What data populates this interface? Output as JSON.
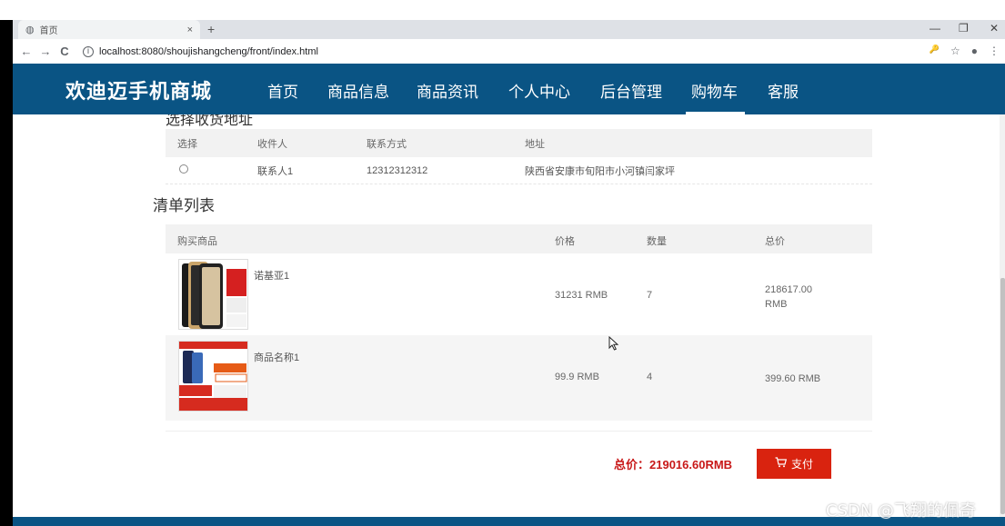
{
  "browser": {
    "tab_title": "首页",
    "tab_close": "×",
    "new_tab": "+",
    "url": "localhost:8080/shoujishangcheng/front/index.html",
    "back_icon": "←",
    "forward_icon": "→",
    "reload_icon": "C",
    "info_icon": "i",
    "key_icon": "🔑",
    "star_icon": "☆",
    "account_icon": "●",
    "menu_icon": "⋮",
    "minimize": "—",
    "restore": "❐",
    "close": "✕"
  },
  "navbar": {
    "brand": "欢迪迈手机商城",
    "items": [
      "首页",
      "商品信息",
      "商品资讯",
      "个人中心",
      "后台管理",
      "购物车",
      "客服"
    ],
    "active_index": 5,
    "background": "#0a5484"
  },
  "address_section": {
    "title": "选择收货地址",
    "headers": [
      "选择",
      "收件人",
      "联系方式",
      "地址"
    ],
    "rows": [
      {
        "recipient": "联系人1",
        "phone": "12312312312",
        "address": "陕西省安康市旬阳市小河镇闫家坪"
      }
    ]
  },
  "order_section": {
    "title": "清单列表",
    "headers": [
      "购买商品",
      "价格",
      "数量",
      "总价"
    ],
    "items": [
      {
        "name": "诺基亚1",
        "price": "31231 RMB",
        "qty": "7",
        "total": "218617.00 RMB"
      },
      {
        "name": "商品名称1",
        "price": "99.9 RMB",
        "qty": "4",
        "total": "399.60 RMB"
      }
    ],
    "total_label": "总价：219016.60RMB",
    "pay_label": "支付",
    "pay_color": "#d9230f"
  },
  "watermark": "CSDN @飞翔的佩奇"
}
